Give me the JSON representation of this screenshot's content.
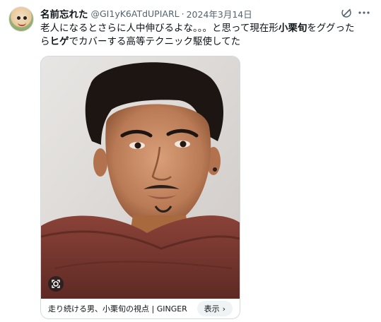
{
  "post": {
    "display_name": "名前忘れた",
    "handle": "@GI1yK6ATdUPIARL",
    "separator": "·",
    "date": "2024年3月14日",
    "text": {
      "line1_a": "老人になるとさらに人中伸びるよな。。。と思って現在形",
      "line1_bold": "小栗旬",
      "line1_b": "をググった",
      "line2_a": "ら",
      "line2_bold": "ヒゲ",
      "line2_b": "でカバーする高等テクニック駆使してた"
    },
    "icons": {
      "grok": "grok-icon",
      "more": "more-icon",
      "lens": "lens-icon"
    }
  },
  "card": {
    "title": "走り続ける男、小栗旬の視点 | GINGER",
    "button_label": "表示",
    "button_chevron": "›"
  },
  "colors": {
    "text_primary": "#0f1419",
    "text_secondary": "#536471",
    "card_border": "#cfd9de",
    "button_bg": "#eff3f4",
    "sweater": "#7b3b33"
  }
}
